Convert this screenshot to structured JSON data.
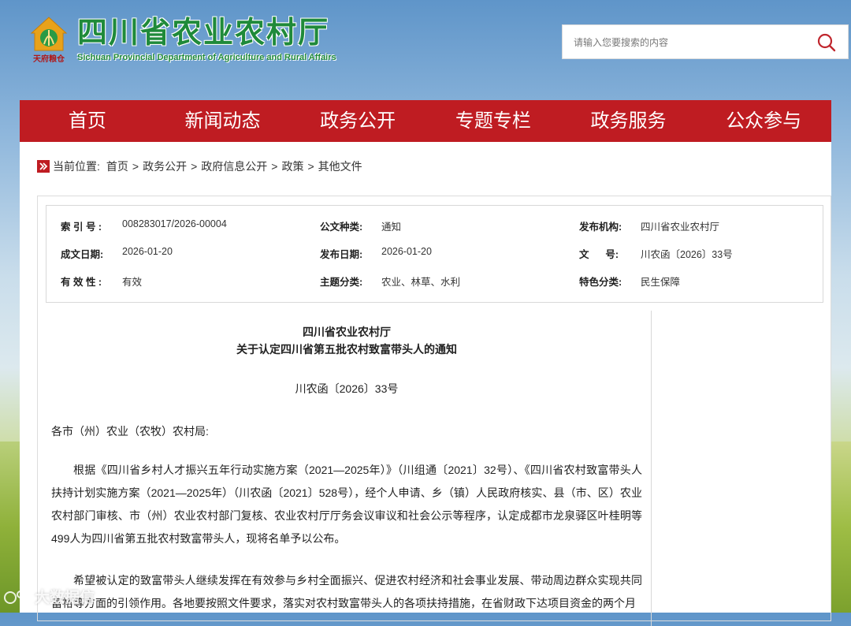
{
  "header": {
    "site_title": "四川省农业农村厅",
    "site_subtitle": "Sichuan Provincial Department of Agriculture and Rural Affairs",
    "logo_caption": "天府粮仓",
    "search_placeholder": "请输入您要搜索的内容"
  },
  "nav": {
    "items": [
      "首页",
      "新闻动态",
      "政务公开",
      "专题专栏",
      "政务服务",
      "公众参与"
    ]
  },
  "breadcrumb": {
    "label": "当前位置:",
    "items": [
      "首页",
      "政务公开",
      "政府信息公开",
      "政策",
      "其他文件"
    ],
    "separator": ">"
  },
  "meta": {
    "index_label": "索 引 号 :",
    "index_value": "008283017/2026-00004",
    "doc_type_label": "公文种类:",
    "doc_type_value": "通知",
    "publisher_label": "发布机构:",
    "publisher_value": "四川省农业农村厅",
    "created_label": "成文日期:",
    "created_value": "2026-01-20",
    "published_label": "发布日期:",
    "published_value": "2026-01-20",
    "docno_label": "文      号:",
    "docno_value": "川农函〔2026〕33号",
    "validity_label": "有 效 性 :",
    "validity_value": "有效",
    "topic_label": "主题分类:",
    "topic_value": "农业、林草、水利",
    "special_label": "特色分类:",
    "special_value": "民生保障"
  },
  "document": {
    "title_line1": "四川省农业农村厅",
    "title_line2": "关于认定四川省第五批农村致富带头人的通知",
    "number": "川农函〔2026〕33号",
    "addressee": "各市（州）农业（农牧）农村局:",
    "para1": "根据《四川省乡村人才振兴五年行动实施方案（2021—2025年）》（川组通〔2021〕32号）、《四川省农村致富带头人扶持计划实施方案（2021—2025年）（川农函〔2021〕528号），经个人申请、乡（镇）人民政府核实、县（市、区）农业农村部门审核、市（州）农业农村部门复核、农业农村厅厅务会议审议和社会公示等程序，认定成都市龙泉驿区叶桂明等499人为四川省第五批农村致富带头人，现将名单予以公布。",
    "para2": "希望被认定的致富带头人继续发挥在有效参与乡村全面振兴、促进农村经济和社会事业发展、带动周边群众实现共同富裕等方面的引领作用。各地要按照文件要求，落实对农村致富带头人的各项扶持措施，在省财政下达项目资金的两个月"
  },
  "watermark": {
    "text": "大数据信"
  },
  "colors": {
    "nav_red": "#bf1c22",
    "brand_green": "#1f8a3a"
  }
}
